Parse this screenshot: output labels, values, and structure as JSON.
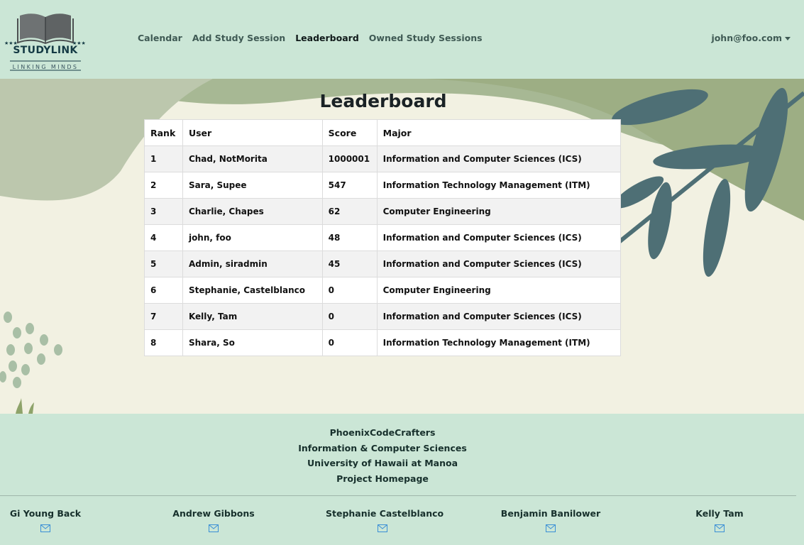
{
  "brand": {
    "name": "STUDYLINK",
    "tagline": "LINKING MINDS"
  },
  "nav": {
    "links": [
      "Calendar",
      "Add Study Session",
      "Leaderboard",
      "Owned Study Sessions"
    ],
    "active": "Leaderboard",
    "user": "john@foo.com"
  },
  "page": {
    "title": "Leaderboard"
  },
  "table": {
    "headers": [
      "Rank",
      "User",
      "Score",
      "Major"
    ],
    "rows": [
      [
        "1",
        "Chad, NotMorita",
        "1000001",
        "Information and Computer Sciences (ICS)"
      ],
      [
        "2",
        "Sara, Supee",
        "547",
        "Information Technology Management (ITM)"
      ],
      [
        "3",
        "Charlie, Chapes",
        "62",
        "Computer Engineering"
      ],
      [
        "4",
        "john, foo",
        "48",
        "Information and Computer Sciences (ICS)"
      ],
      [
        "5",
        "Admin, siradmin",
        "45",
        "Information and Computer Sciences (ICS)"
      ],
      [
        "6",
        "Stephanie, Castelblanco",
        "0",
        "Computer Engineering"
      ],
      [
        "7",
        "Kelly, Tam",
        "0",
        "Information and Computer Sciences (ICS)"
      ],
      [
        "8",
        "Shara, So",
        "0",
        "Information Technology Management (ITM)"
      ]
    ]
  },
  "footer": {
    "lines": [
      "PhoenixCodeCrafters",
      "Information & Computer Sciences",
      "University of Hawaii at Manoa",
      "Project Homepage"
    ],
    "team": [
      "Gi Young Back",
      "Andrew Gibbons",
      "Stephanie Castelblanco",
      "Benjamin Banilower",
      "Kelly Tam"
    ]
  },
  "colors": {
    "header_bg": "#cbe6d6",
    "footer_bg": "#cbe6d6",
    "accent_icon": "#3a8fd6"
  }
}
